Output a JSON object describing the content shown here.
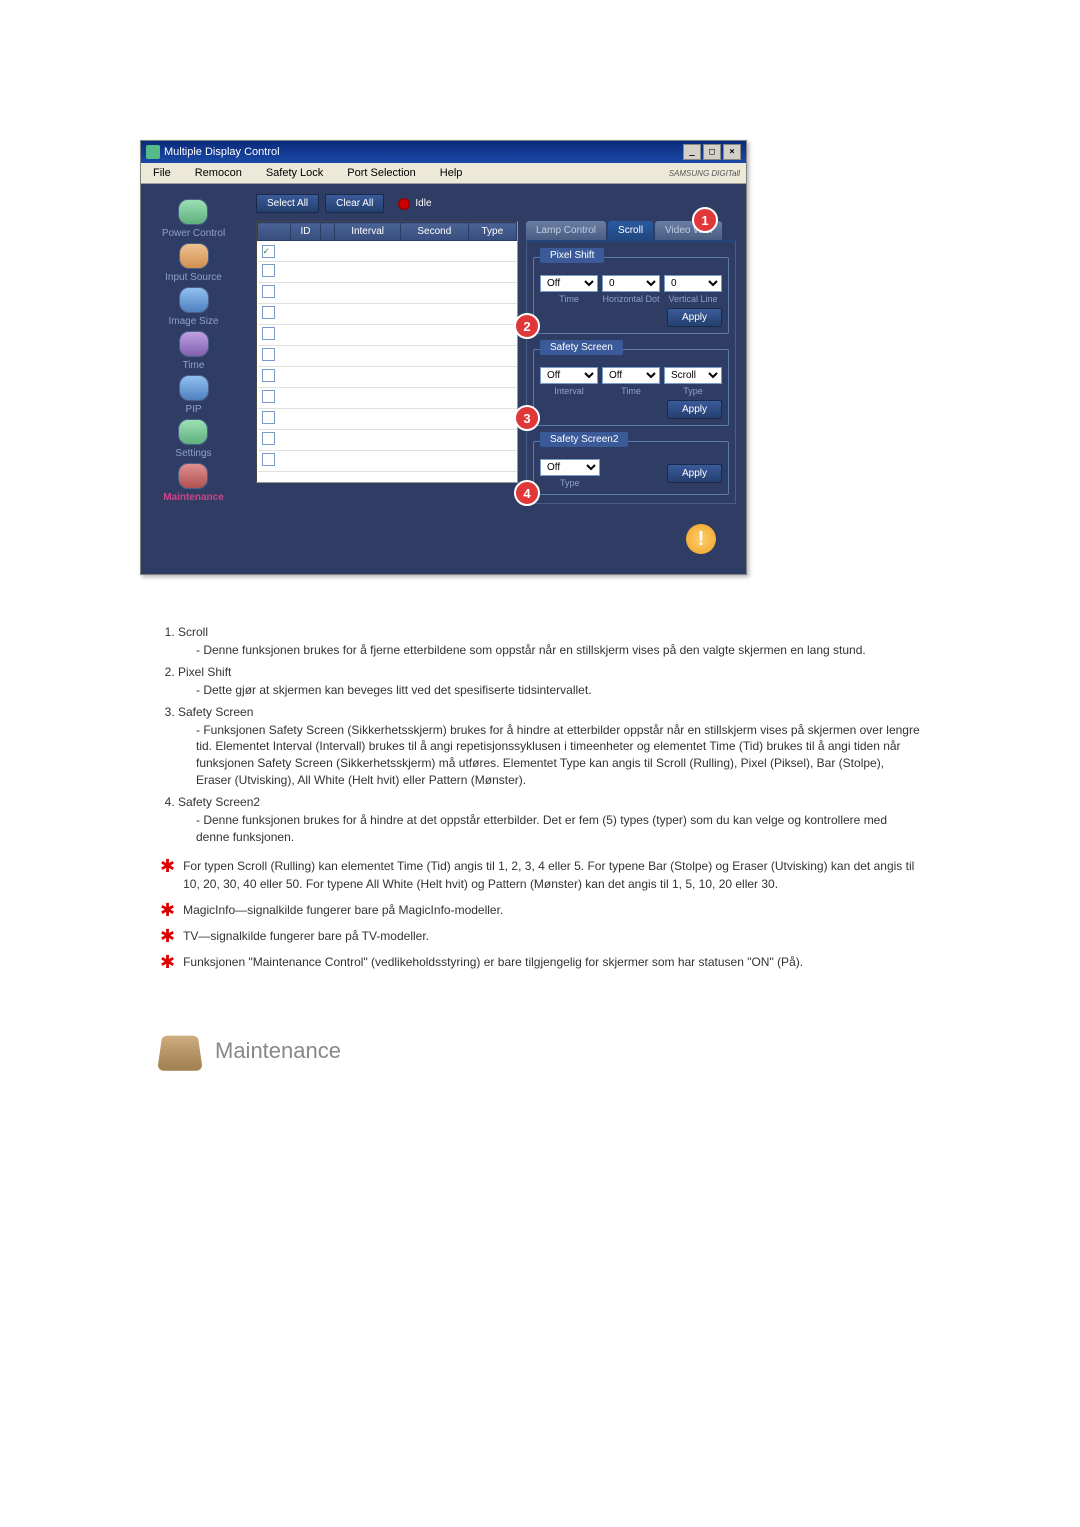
{
  "titlebar": {
    "title": "Multiple Display Control"
  },
  "menu": [
    "File",
    "Remocon",
    "Safety Lock",
    "Port Selection",
    "Help"
  ],
  "brand": "SAMSUNG DIGITall",
  "sidebar": [
    {
      "label": "Power Control"
    },
    {
      "label": "Input Source"
    },
    {
      "label": "Image Size"
    },
    {
      "label": "Time"
    },
    {
      "label": "PIP"
    },
    {
      "label": "Settings"
    },
    {
      "label": "Maintenance",
      "active": true
    }
  ],
  "toolbar": {
    "selectAll": "Select All",
    "clearAll": "Clear All",
    "idle": "Idle"
  },
  "columns": [
    "",
    "ID",
    "",
    "Interval",
    "Second",
    "Type"
  ],
  "tabs": [
    "Lamp Control",
    "Scroll",
    "Video Wall"
  ],
  "pixelShift": {
    "legend": "Pixel Shift",
    "value1": "Off",
    "value2": "0",
    "value3": "0",
    "label1": "Time",
    "label2": "Horizontal Dot",
    "label3": "Vertical Line",
    "apply": "Apply"
  },
  "safetyScreen": {
    "legend": "Safety Screen",
    "value1": "Off",
    "value2": "Off",
    "value3": "Scroll",
    "label1": "Interval",
    "label2": "Time",
    "label3": "Type",
    "apply": "Apply"
  },
  "safetyScreen2": {
    "legend": "Safety Screen2",
    "value1": "Off",
    "label1": "Type",
    "apply": "Apply"
  },
  "markers": [
    "1",
    "2",
    "3",
    "4"
  ],
  "doc": {
    "items": [
      {
        "title": "Scroll",
        "desc": "Denne funksjonen brukes for å fjerne etterbildene som oppstår når en stillskjerm vises på den valgte skjermen en lang stund."
      },
      {
        "title": "Pixel Shift",
        "desc": "Dette gjør at skjermen kan beveges litt ved det spesifiserte tidsintervallet."
      },
      {
        "title": "Safety Screen",
        "desc": "Funksjonen Safety Screen (Sikkerhetsskjerm) brukes for å hindre at etterbilder oppstår når en stillskjerm vises på skjermen over lengre tid. Elementet Interval (Intervall) brukes til å angi repetisjonssyklusen i timeenheter og elementet Time (Tid) brukes til å angi tiden når funksjonen Safety Screen (Sikkerhetsskjerm) må utføres. Elementet Type kan angis til Scroll (Rulling), Pixel (Piksel), Bar (Stolpe), Eraser (Utvisking), All White (Helt hvit) eller Pattern (Mønster)."
      },
      {
        "title": "Safety Screen2",
        "desc": "Denne funksjonen brukes for å hindre at det oppstår etterbilder. Det er fem (5) types (typer) som du kan velge og kontrollere med denne funksjonen."
      }
    ],
    "notes": [
      "For typen Scroll (Rulling) kan elementet Time (Tid) angis til 1, 2, 3, 4 eller 5. For typene Bar (Stolpe) og Eraser (Utvisking) kan det angis til 10, 20, 30, 40 eller 50. For typene All White (Helt hvit) og Pattern (Mønster) kan det angis til 1, 5, 10, 20 eller 30.",
      "MagicInfo—signalkilde fungerer bare på MagicInfo-modeller.",
      "TV—signalkilde fungerer bare på TV-modeller.",
      "Funksjonen \"Maintenance Control\" (vedlikeholdsstyring) er bare tilgjengelig for skjermer som har statusen \"ON\" (På)."
    ]
  },
  "section": "Maintenance"
}
